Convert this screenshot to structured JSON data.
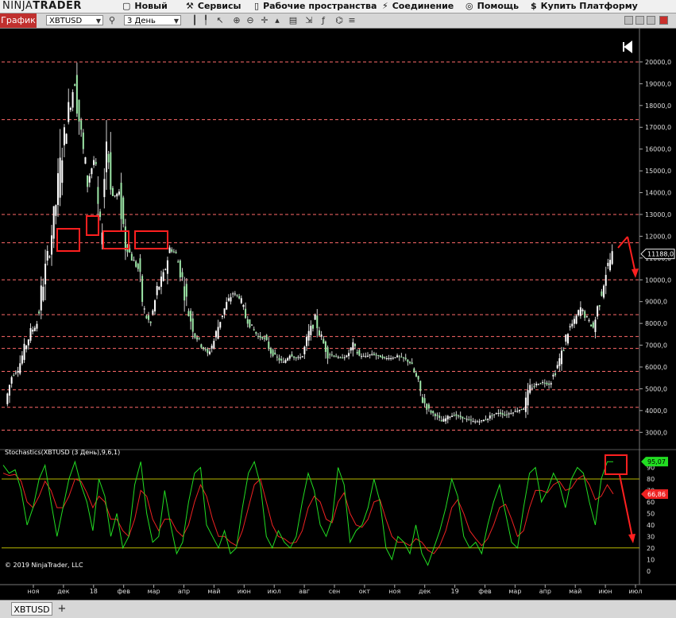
{
  "app": {
    "logo_ninja": "NINJA",
    "logo_trader": "TRADER"
  },
  "menu": [
    {
      "label": "Новый",
      "icon": "new-window-icon"
    },
    {
      "label": "Сервисы",
      "icon": "tools-icon"
    },
    {
      "label": "Рабочие пространства",
      "icon": "document-icon"
    },
    {
      "label": "Соединение",
      "icon": "connection-plug-icon"
    },
    {
      "label": "Помощь",
      "icon": "help-lifebuoy-icon"
    },
    {
      "label": "Купить Платформу",
      "icon": "dollar-icon"
    }
  ],
  "toolbar": {
    "chart_tab": "График",
    "instrument": "XBTUSD",
    "interval": "3 День"
  },
  "indicator": {
    "label": "Stochastics(XBTUSD (3 День),9,6,1)",
    "k_value": "95,07",
    "d_value": "66,86",
    "k_color": "#22dd22",
    "d_color": "#ee2222"
  },
  "copyright": "© 2019 NinjaTrader, LLC",
  "price_label": "11188,0",
  "statusbar": {
    "instrument_tab": "XBTUSD",
    "add_tab": "+"
  },
  "chart_data": {
    "type": "candlestick",
    "price_axis": {
      "ticks": [
        "3000,0",
        "4000,0",
        "5000,0",
        "6000,0",
        "7000,0",
        "8000,0",
        "9000,0",
        "10000,0",
        "11000,0",
        "12000,0",
        "13000,0",
        "14000,0",
        "15000,0",
        "16000,0",
        "17000,0",
        "18000,0",
        "19000,0",
        "20000,0"
      ],
      "ylim": [
        2500,
        20800
      ]
    },
    "stoch_axis": {
      "ticks": [
        "0",
        "10",
        "20",
        "30",
        "40",
        "50",
        "60",
        "70",
        "80",
        "90"
      ],
      "ylim": [
        -5,
        100
      ]
    },
    "time_axis": [
      "ноя",
      "дек",
      "18",
      "фев",
      "мар",
      "апр",
      "май",
      "июн",
      "июл",
      "авг",
      "сен",
      "окт",
      "ноя",
      "дек",
      "19",
      "фев",
      "мар",
      "апр",
      "май",
      "июн",
      "июл"
    ],
    "horizontal_levels": [
      20000,
      17350,
      13000,
      11700,
      10000,
      8400,
      7400,
      6850,
      5800,
      4950,
      4150,
      3100
    ],
    "stoch_levels": [
      80,
      20
    ],
    "price_path": [
      [
        0,
        4300
      ],
      [
        3,
        5600
      ],
      [
        6,
        5900
      ],
      [
        8,
        6800
      ],
      [
        10,
        7600
      ],
      [
        11,
        8000
      ],
      [
        12,
        10000
      ],
      [
        13,
        11500
      ],
      [
        14,
        13500
      ],
      [
        15,
        16000
      ],
      [
        16,
        17800
      ],
      [
        17,
        19200
      ],
      [
        18,
        16500
      ],
      [
        19,
        14500
      ],
      [
        20,
        15500
      ],
      [
        21,
        11800
      ],
      [
        22,
        16500
      ],
      [
        23,
        13800
      ],
      [
        24,
        14000
      ],
      [
        25,
        11700
      ],
      [
        26,
        11000
      ],
      [
        27,
        10500
      ],
      [
        28,
        8400
      ],
      [
        29,
        8000
      ],
      [
        30,
        9500
      ],
      [
        31,
        10200
      ],
      [
        32,
        11400
      ],
      [
        33,
        11200
      ],
      [
        34,
        10000
      ],
      [
        35,
        8500
      ],
      [
        36,
        7500
      ],
      [
        37,
        7000
      ],
      [
        38,
        6600
      ],
      [
        39,
        7200
      ],
      [
        40,
        8200
      ],
      [
        41,
        8900
      ],
      [
        42,
        9400
      ],
      [
        43,
        9200
      ],
      [
        44,
        8300
      ],
      [
        45,
        7800
      ],
      [
        46,
        7400
      ],
      [
        47,
        7300
      ],
      [
        48,
        6700
      ],
      [
        49,
        6400
      ],
      [
        50,
        6200
      ],
      [
        51,
        6600
      ],
      [
        52,
        6400
      ],
      [
        53,
        6500
      ],
      [
        54,
        7500
      ],
      [
        55,
        8200
      ],
      [
        56,
        7300
      ],
      [
        57,
        6600
      ],
      [
        58,
        6500
      ],
      [
        59,
        6400
      ],
      [
        60,
        6500
      ],
      [
        61,
        7000
      ],
      [
        62,
        6500
      ],
      [
        63,
        6500
      ],
      [
        64,
        6600
      ],
      [
        65,
        6500
      ],
      [
        66,
        6400
      ],
      [
        67,
        6400
      ],
      [
        68,
        6500
      ],
      [
        69,
        6400
      ],
      [
        70,
        6200
      ],
      [
        71,
        5500
      ],
      [
        72,
        4500
      ],
      [
        73,
        4000
      ],
      [
        74,
        3800
      ],
      [
        75,
        3500
      ],
      [
        76,
        3700
      ],
      [
        77,
        3800
      ],
      [
        78,
        3700
      ],
      [
        79,
        3600
      ],
      [
        80,
        3500
      ],
      [
        81,
        3500
      ],
      [
        82,
        3600
      ],
      [
        83,
        3800
      ],
      [
        84,
        3900
      ],
      [
        85,
        3800
      ],
      [
        86,
        3900
      ],
      [
        87,
        4000
      ],
      [
        88,
        4100
      ],
      [
        89,
        5000
      ],
      [
        90,
        5200
      ],
      [
        91,
        5300
      ],
      [
        92,
        5200
      ],
      [
        93,
        5800
      ],
      [
        94,
        6600
      ],
      [
        95,
        7700
      ],
      [
        96,
        8100
      ],
      [
        97,
        8700
      ],
      [
        98,
        8200
      ],
      [
        99,
        7800
      ],
      [
        100,
        9100
      ],
      [
        101,
        10400
      ],
      [
        102,
        11188
      ]
    ],
    "series": [
      {
        "name": "K",
        "color": "#22dd22"
      },
      {
        "name": "D",
        "color": "#ee2222"
      }
    ],
    "k_values": [
      92,
      85,
      88,
      70,
      40,
      55,
      80,
      92,
      60,
      30,
      55,
      80,
      95,
      75,
      60,
      35,
      80,
      65,
      30,
      50,
      20,
      30,
      75,
      95,
      50,
      25,
      30,
      70,
      40,
      15,
      25,
      60,
      85,
      90,
      40,
      30,
      20,
      35,
      15,
      20,
      55,
      85,
      95,
      75,
      30,
      20,
      35,
      25,
      20,
      30,
      60,
      85,
      70,
      40,
      30,
      45,
      90,
      75,
      25,
      35,
      40,
      55,
      80,
      60,
      20,
      10,
      30,
      25,
      15,
      40,
      15,
      5,
      20,
      35,
      55,
      80,
      65,
      30,
      20,
      25,
      15,
      40,
      60,
      75,
      50,
      25,
      20,
      55,
      85,
      90,
      60,
      70,
      85,
      75,
      55,
      80,
      90,
      85,
      60,
      40,
      80,
      95,
      95
    ],
    "d_values": [
      85,
      83,
      84,
      78,
      60,
      55,
      65,
      78,
      70,
      55,
      55,
      65,
      80,
      78,
      68,
      55,
      65,
      60,
      45,
      45,
      35,
      30,
      45,
      70,
      65,
      45,
      35,
      45,
      45,
      35,
      30,
      40,
      60,
      75,
      65,
      45,
      30,
      30,
      25,
      22,
      35,
      55,
      75,
      80,
      60,
      40,
      30,
      28,
      24,
      25,
      35,
      55,
      65,
      60,
      45,
      42,
      60,
      68,
      50,
      40,
      38,
      45,
      60,
      62,
      45,
      30,
      25,
      25,
      22,
      28,
      25,
      18,
      15,
      22,
      35,
      55,
      62,
      50,
      35,
      28,
      22,
      28,
      40,
      55,
      58,
      45,
      30,
      35,
      55,
      70,
      70,
      68,
      75,
      78,
      70,
      72,
      80,
      83,
      75,
      62,
      65,
      75,
      67
    ]
  },
  "annotations": {
    "box_color": "#ff2020",
    "arrow_color": "#ff2020"
  }
}
